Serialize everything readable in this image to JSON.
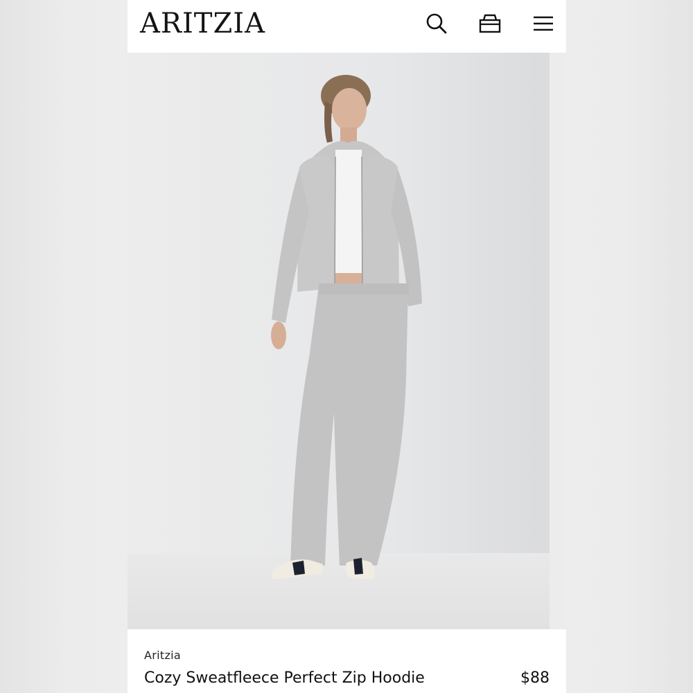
{
  "header": {
    "logo": "ARITZIA",
    "icons": [
      "search-icon",
      "bag-icon",
      "menu-icon"
    ]
  },
  "product": {
    "brand": "Aritzia",
    "name": "Cozy Sweatfleece Perfect Zip Hoodie",
    "price": "$88"
  },
  "colors": {
    "background": "#ededed",
    "text": "#111111",
    "garment": "#c9c9c9"
  }
}
